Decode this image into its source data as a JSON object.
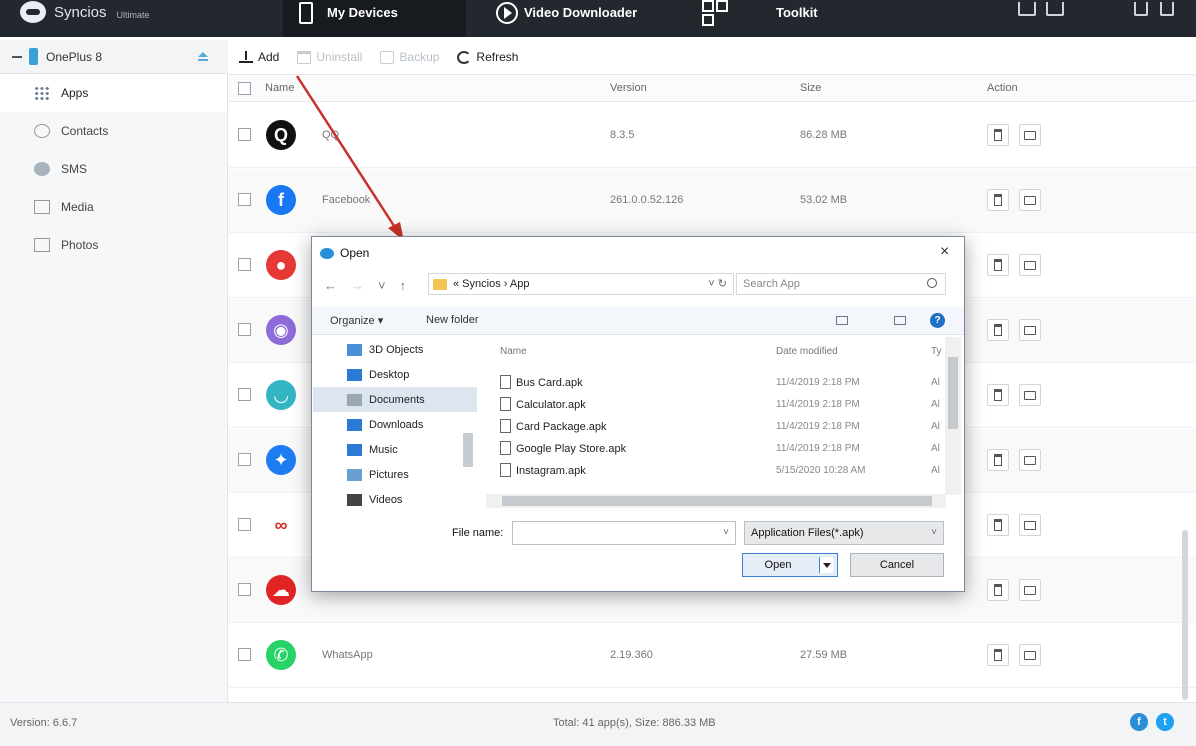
{
  "app": {
    "brand_name": "Syncios",
    "brand_edition": "Ultimate",
    "nav_tabs": [
      {
        "label": "My Devices",
        "active": true
      },
      {
        "label": "Video Downloader",
        "active": false
      },
      {
        "label": "Toolkit",
        "active": false
      }
    ]
  },
  "device": {
    "name": "OnePlus 8"
  },
  "sidebar": {
    "items": [
      {
        "label": "Apps",
        "icon": "apps-grid-icon",
        "active": true
      },
      {
        "label": "Contacts",
        "icon": "contacts-icon",
        "active": false
      },
      {
        "label": "SMS",
        "icon": "sms-icon",
        "active": false
      },
      {
        "label": "Media",
        "icon": "media-icon",
        "active": false
      },
      {
        "label": "Photos",
        "icon": "photos-icon",
        "active": false
      }
    ]
  },
  "toolbar": {
    "add": "Add",
    "uninstall": "Uninstall",
    "backup": "Backup",
    "refresh": "Refresh"
  },
  "table": {
    "columns": [
      "Name",
      "Version",
      "Size",
      "Action"
    ],
    "rows": [
      {
        "name": "QQ",
        "version": "8.3.5",
        "size": "86.28 MB",
        "icon_color": "#111111",
        "icon_char": "Q"
      },
      {
        "name": "Facebook",
        "version": "261.0.0.52.126",
        "size": "53.02 MB",
        "icon_color": "#1877f2",
        "icon_char": "f"
      },
      {
        "name": "",
        "version": "",
        "size": "",
        "icon_color": "#e53935",
        "icon_char": "●"
      },
      {
        "name": "",
        "version": "",
        "size": "",
        "icon_color": "#8e6bd8",
        "icon_char": "◉"
      },
      {
        "name": "",
        "version": "",
        "size": "",
        "icon_color": "#33b5c4",
        "icon_char": "◡"
      },
      {
        "name": "",
        "version": "",
        "size": "",
        "icon_color": "#1e7cf2",
        "icon_char": "✦"
      },
      {
        "name": "",
        "version": "",
        "size": "",
        "icon_color": "#ffffff",
        "icon_char": "∞"
      },
      {
        "name": "",
        "version": "",
        "size": "",
        "icon_color": "#e02424",
        "icon_char": "☁"
      },
      {
        "name": "WhatsApp",
        "version": "2.19.360",
        "size": "27.59 MB",
        "icon_color": "#25d366",
        "icon_char": "✆"
      }
    ]
  },
  "status": {
    "version": "Version: 6.6.7",
    "total": "Total: 41 app(s), Size: 886.33 MB"
  },
  "dialog": {
    "title": "Open",
    "close": "×",
    "address": "« Syncios › App",
    "search_placeholder": "Search App",
    "organize": "Organize ▾",
    "new_folder": "New folder",
    "tree": [
      {
        "label": "3D Objects",
        "icon_color": "#4a90d9",
        "selected": false
      },
      {
        "label": "Desktop",
        "icon_color": "#2b7bd4",
        "selected": false
      },
      {
        "label": "Documents",
        "icon_color": "#9aa7b4",
        "selected": true
      },
      {
        "label": "Downloads",
        "icon_color": "#2b7bd4",
        "selected": false
      },
      {
        "label": "Music",
        "icon_color": "#2b7bd4",
        "selected": false
      },
      {
        "label": "Pictures",
        "icon_color": "#6aa0d0",
        "selected": false
      },
      {
        "label": "Videos",
        "icon_color": "#444444",
        "selected": false
      }
    ],
    "file_columns": [
      "Name",
      "Date modified",
      "Ty"
    ],
    "files": [
      {
        "name": "Bus Card.apk",
        "date": "11/4/2019 2:18 PM",
        "type": "Al"
      },
      {
        "name": "Calculator.apk",
        "date": "11/4/2019 2:18 PM",
        "type": "Al"
      },
      {
        "name": "Card Package.apk",
        "date": "11/4/2019 2:18 PM",
        "type": "Al"
      },
      {
        "name": "Google Play Store.apk",
        "date": "11/4/2019 2:18 PM",
        "type": "Al"
      },
      {
        "name": "Instagram.apk",
        "date": "5/15/2020 10:28 AM",
        "type": "Al"
      }
    ],
    "file_name_label": "File name:",
    "file_name_value": "",
    "file_type": "Application Files(*.apk)",
    "open_button": "Open",
    "cancel_button": "Cancel"
  },
  "colors": {
    "titlebar": "#23272e",
    "accent": "#2a8fd9",
    "arrow": "#c8322c"
  }
}
